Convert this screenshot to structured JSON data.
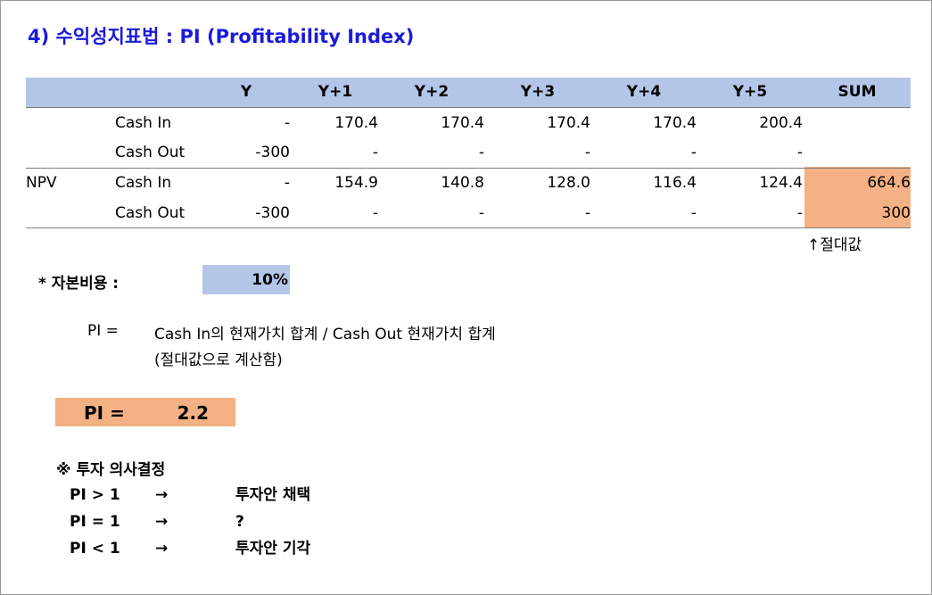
{
  "title": "4) 수익성지표법 : PI (Profitability Index)",
  "table": {
    "headers": [
      "Y",
      "Y+1",
      "Y+2",
      "Y+3",
      "Y+4",
      "Y+5",
      "SUM"
    ],
    "rows": [
      {
        "group": "",
        "label": "Cash In",
        "values": [
          "-",
          "170.4",
          "170.4",
          "170.4",
          "170.4",
          "200.4",
          ""
        ]
      },
      {
        "group": "",
        "label": "Cash Out",
        "values": [
          "-300",
          "-",
          "-",
          "-",
          "-",
          "-",
          ""
        ]
      },
      {
        "group": "NPV",
        "label": "Cash In",
        "values": [
          "-",
          "154.9",
          "140.8",
          "128.0",
          "116.4",
          "124.4",
          "664.6"
        ]
      },
      {
        "group": "",
        "label": "Cash Out",
        "values": [
          "-300",
          "-",
          "-",
          "-",
          "-",
          "-",
          "300"
        ]
      }
    ],
    "abs_note": "↑절대값"
  },
  "capital_cost": {
    "label": "* 자본비용 :",
    "value": "10%"
  },
  "pi_formula": {
    "label": "PI =",
    "line1": "Cash In의 현재가치 합계 / Cash Out 현재가치 합계",
    "line2": "(절대값으로 계산함)"
  },
  "pi_result": {
    "label": "PI =",
    "value": "2.2"
  },
  "decision": {
    "title": "※ 투자 의사결정",
    "items": [
      {
        "condition": "PI > 1",
        "arrow": "→",
        "result": "투자안 채택"
      },
      {
        "condition": "PI = 1",
        "arrow": "→",
        "result": "?"
      },
      {
        "condition": "PI < 1",
        "arrow": "→",
        "result": "투자안 기각"
      }
    ]
  },
  "colors": {
    "title": "#1a1adb",
    "header_bg": "#b4c6e7",
    "highlight_bg": "#f4b183"
  }
}
